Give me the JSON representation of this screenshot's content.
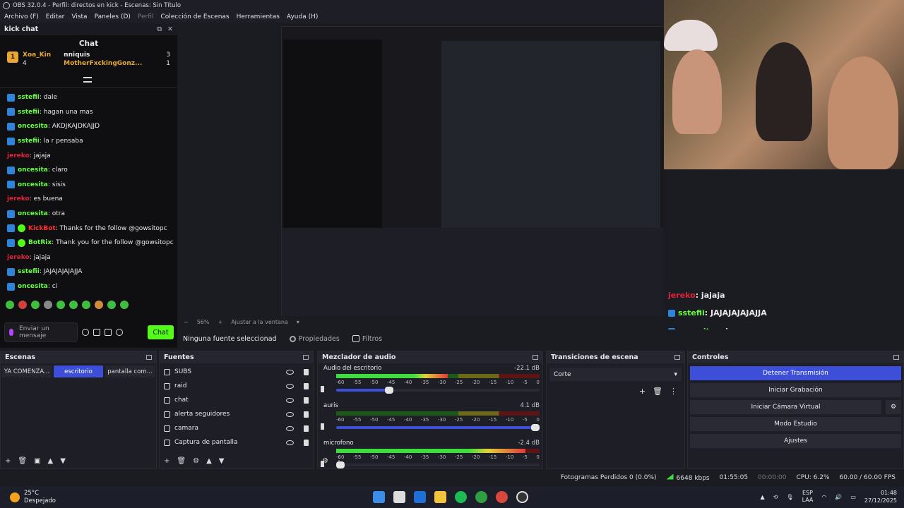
{
  "window": {
    "title": "OBS 32.0.4 - Perfil: directos en kick - Escenas: Sin Título"
  },
  "menu": {
    "items": [
      "Archivo (F)",
      "Editar",
      "Vista",
      "Paneles (D)",
      "Perfil",
      "Colección de Escenas",
      "Herramientas",
      "Ayuda (H)"
    ]
  },
  "chat_dock": {
    "title": "kick chat",
    "chat_heading": "Chat",
    "leader_1": {
      "rank": "1",
      "name": "Xoa_Kin",
      "count": "4"
    },
    "leader_2": {
      "name": "nniquis",
      "count": "3"
    },
    "leader_3": {
      "name": "MotherFxckingGonz...",
      "count": "1"
    },
    "messages": [
      {
        "user": "sstefii",
        "text": ": dale",
        "style": "green"
      },
      {
        "user": "sstefii",
        "text": ": hagan una mas",
        "style": "green"
      },
      {
        "user": "oncesita",
        "text": ": AKDJKAJDKAJJD",
        "style": "green"
      },
      {
        "user": "sstefii",
        "text": ": la r pensaba",
        "style": "green"
      },
      {
        "user": "jereko",
        "text": ": jajaja",
        "style": "red"
      },
      {
        "user": "oncesita",
        "text": ": claro",
        "style": "green"
      },
      {
        "user": "oncesita",
        "text": ": sisis",
        "style": "green"
      },
      {
        "user": "jereko",
        "text": ": es buena",
        "style": "red"
      },
      {
        "user": "oncesita",
        "text": ": otra",
        "style": "green"
      },
      {
        "user": "KickBot",
        "text": ": Thanks for the follow @gowsitopc",
        "style": "bot-red"
      },
      {
        "user": "BotRix",
        "text": ": Thank you for the follow @gowsitopc",
        "style": "bot-green"
      },
      {
        "user": "jereko",
        "text": ": jajaja",
        "style": "red"
      },
      {
        "user": "sstefii",
        "text": ": JAJAJAJAJAJJA",
        "style": "green"
      },
      {
        "user": "oncesita",
        "text": ": ci",
        "style": "green"
      }
    ],
    "input_placeholder": "Enviar un mensaje",
    "send_label": "Chat"
  },
  "overlay_chat": {
    "messages": [
      {
        "user": "jereko",
        "text": ": jajaja",
        "style": "red"
      },
      {
        "user": "sstefii",
        "text": ": JAJAJAJAJAJJA",
        "style": "green"
      },
      {
        "user": "oncesita",
        "text": ": ci",
        "style": "green"
      }
    ]
  },
  "preview_bar": {
    "zoom": "56%",
    "fit_label": "Ajustar a la ventana"
  },
  "source_bar": {
    "no_source": "Ninguna fuente seleccionad",
    "properties": "Propiedades",
    "filters": "Filtros"
  },
  "scenes": {
    "title": "Escenas",
    "items": [
      {
        "label": "YA COMENZA...",
        "active": false
      },
      {
        "label": "escritorio",
        "active": true
      },
      {
        "label": "pantalla com...",
        "active": false
      }
    ]
  },
  "sources": {
    "title": "Fuentes",
    "items": [
      "SUBS",
      "raid",
      "chat",
      "alerta seguidores",
      "camara",
      "Captura de pantalla"
    ]
  },
  "mixer": {
    "title": "Mezclador de audio",
    "ticks": [
      "-60",
      "-55",
      "-50",
      "-45",
      "-40",
      "-35",
      "-30",
      "-25",
      "-20",
      "-15",
      "-10",
      "-5",
      "0"
    ],
    "channels": [
      {
        "name": "Audio del escritorio",
        "db": "-22.1 dB",
        "level": 0.55,
        "volume": 0.28
      },
      {
        "name": "auris",
        "db": "4.1 dB",
        "level": 0.0,
        "volume": 1.0
      },
      {
        "name": "microfono",
        "db": "-2.4 dB",
        "level": 0.93,
        "volume": 0.0
      }
    ]
  },
  "transitions": {
    "title": "Transiciones de escena",
    "selected": "Corte"
  },
  "controls": {
    "title": "Controles",
    "buttons": [
      "Detener Transmisión",
      "Iniciar Grabación",
      "Iniciar Cámara Virtual",
      "Modo Estudio",
      "Ajustes"
    ]
  },
  "status": {
    "dropped": "Fotogramas Perdidos 0 (0.0%)",
    "bitrate": "6648 kbps",
    "stream_time": "01:55:05",
    "rec_time": "00:00:00",
    "cpu": "CPU: 6.2%",
    "fps": "60.00 / 60.00 FPS"
  },
  "taskbar": {
    "temp": "25°C",
    "weather": "Despejado",
    "lang_1": "ESP",
    "lang_2": "LAA",
    "time": "01:48",
    "date": "27/12/2025"
  },
  "colors": {
    "kick_green": "#53fc18",
    "obs_blue": "#3d4fd8",
    "red_user": "#e0233a"
  }
}
